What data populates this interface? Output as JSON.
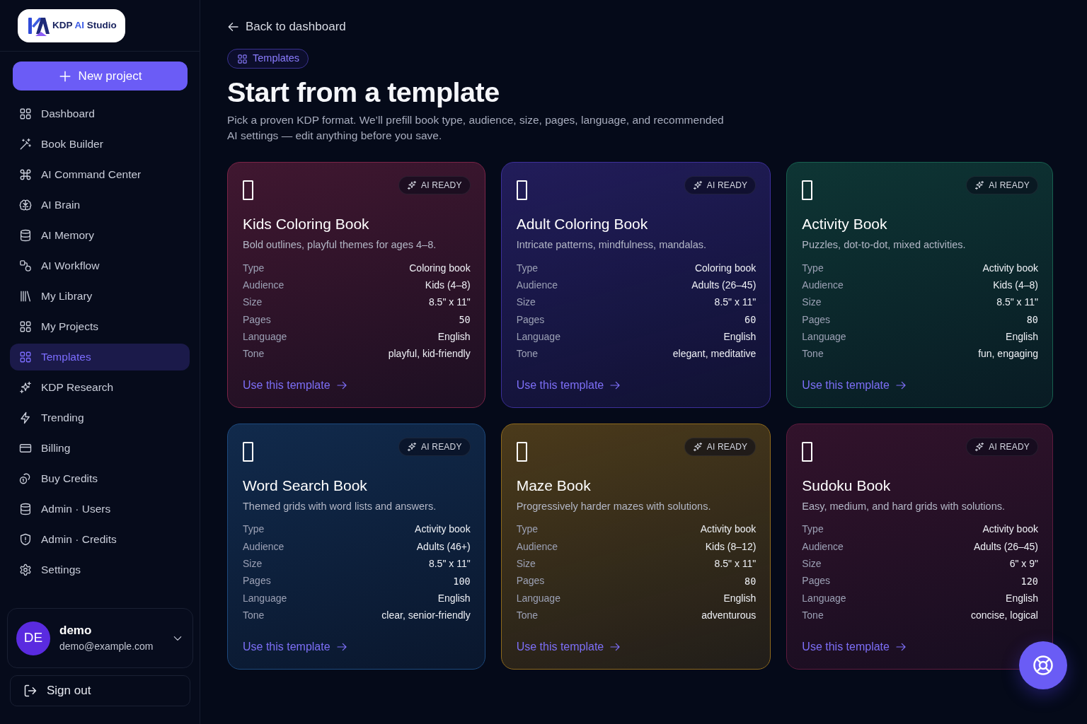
{
  "sidebar": {
    "logo": {
      "parts": [
        {
          "text": "KDP",
          "accent": false
        },
        {
          "text": "AI",
          "accent": true
        },
        {
          "text": "Studio",
          "accent": false
        }
      ]
    },
    "new_project_button": {
      "label": "New project"
    },
    "items": [
      {
        "label": "Dashboard",
        "selected": false
      },
      {
        "label": "Book Builder",
        "selected": false
      },
      {
        "label": "AI Command Center",
        "selected": false
      },
      {
        "label": "AI Brain",
        "selected": false
      },
      {
        "label": "AI Memory",
        "selected": false
      },
      {
        "label": "AI Workflow",
        "selected": false
      },
      {
        "label": "My Library",
        "selected": false
      },
      {
        "label": "My Projects",
        "selected": false
      },
      {
        "label": "Templates",
        "selected": true
      },
      {
        "label": "KDP Research",
        "selected": false
      },
      {
        "label": "Trending",
        "selected": false
      },
      {
        "label": "Billing",
        "selected": false
      },
      {
        "label": "Buy Credits",
        "selected": false
      },
      {
        "label": "Admin · Users",
        "selected": false
      },
      {
        "label": "Admin · Credits",
        "selected": false
      },
      {
        "label": "Settings",
        "selected": false
      }
    ],
    "user": {
      "initials": "DE",
      "name": "demo",
      "email": "demo@example.com"
    },
    "sign_out": {
      "label": "Sign out"
    }
  },
  "back_link": {
    "label": "Back to dashboard"
  },
  "header": {
    "tag": "Templates",
    "title": "Start from a template",
    "description": "Pick a proven KDP format. We’ll prefill book type, audience, size, pages, language, and recommended AI settings — edit anything before you save."
  },
  "templates": [
    {
      "title": "Kids Coloring Book",
      "description": "Bold outlines, playful themes for ages 4–8.",
      "badge": "AI READY",
      "color": "#7b2447",
      "specs": [
        {
          "label": "Type",
          "value": "Coloring book",
          "kind": "text"
        },
        {
          "label": "Audience",
          "value": "Kids (4–8)",
          "kind": "text"
        },
        {
          "label": "Size",
          "value": "8.5\" x 11\"",
          "kind": "text"
        },
        {
          "label": "Pages",
          "value": "50",
          "kind": "number"
        },
        {
          "label": "Language",
          "value": "English",
          "kind": "text"
        },
        {
          "label": "Tone",
          "value": "playful, kid-friendly",
          "kind": "text"
        }
      ],
      "action": "Use this template"
    },
    {
      "title": "Adult Coloring Book",
      "description": "Intricate patterns, mindfulness, mandalas.",
      "badge": "AI READY",
      "color": "#3d2f9a",
      "specs": [
        {
          "label": "Type",
          "value": "Coloring book",
          "kind": "text"
        },
        {
          "label": "Audience",
          "value": "Adults (26–45)",
          "kind": "text"
        },
        {
          "label": "Size",
          "value": "8.5\" x 11\"",
          "kind": "text"
        },
        {
          "label": "Pages",
          "value": "60",
          "kind": "number"
        },
        {
          "label": "Language",
          "value": "English",
          "kind": "text"
        },
        {
          "label": "Tone",
          "value": "elegant, meditative",
          "kind": "text"
        }
      ],
      "action": "Use this template"
    },
    {
      "title": "Activity Book",
      "description": "Puzzles, dot-to-dot, mixed activities.",
      "badge": "AI READY",
      "color": "#17604f",
      "specs": [
        {
          "label": "Type",
          "value": "Activity book",
          "kind": "text"
        },
        {
          "label": "Audience",
          "value": "Kids (4–8)",
          "kind": "text"
        },
        {
          "label": "Size",
          "value": "8.5\" x 11\"",
          "kind": "text"
        },
        {
          "label": "Pages",
          "value": "80",
          "kind": "number"
        },
        {
          "label": "Language",
          "value": "English",
          "kind": "text"
        },
        {
          "label": "Tone",
          "value": "fun, engaging",
          "kind": "text"
        }
      ],
      "action": "Use this template"
    },
    {
      "title": "Word Search Book",
      "description": "Themed grids with word lists and answers.",
      "badge": "AI READY",
      "color": "#1d4a7e",
      "specs": [
        {
          "label": "Type",
          "value": "Activity book",
          "kind": "text"
        },
        {
          "label": "Audience",
          "value": "Adults (46+)",
          "kind": "text"
        },
        {
          "label": "Size",
          "value": "8.5\" x 11\"",
          "kind": "text"
        },
        {
          "label": "Pages",
          "value": "100",
          "kind": "number"
        },
        {
          "label": "Language",
          "value": "English",
          "kind": "text"
        },
        {
          "label": "Tone",
          "value": "clear, senior-friendly",
          "kind": "text"
        }
      ],
      "action": "Use this template"
    },
    {
      "title": "Maze Book",
      "description": "Progressively harder mazes with solutions.",
      "badge": "AI READY",
      "color": "#8f6a1c",
      "specs": [
        {
          "label": "Type",
          "value": "Activity book",
          "kind": "text"
        },
        {
          "label": "Audience",
          "value": "Kids (8–12)",
          "kind": "text"
        },
        {
          "label": "Size",
          "value": "8.5\" x 11\"",
          "kind": "text"
        },
        {
          "label": "Pages",
          "value": "80",
          "kind": "number"
        },
        {
          "label": "Language",
          "value": "English",
          "kind": "text"
        },
        {
          "label": "Tone",
          "value": "adventurous",
          "kind": "text"
        }
      ],
      "action": "Use this template"
    },
    {
      "title": "Sudoku Book",
      "description": "Easy, medium, and hard grids with solutions.",
      "badge": "AI READY",
      "color": "#5e1b3d",
      "specs": [
        {
          "label": "Type",
          "value": "Activity book",
          "kind": "text"
        },
        {
          "label": "Audience",
          "value": "Adults (26–45)",
          "kind": "text"
        },
        {
          "label": "Size",
          "value": "6\" x 9\"",
          "kind": "text"
        },
        {
          "label": "Pages",
          "value": "120",
          "kind": "number"
        },
        {
          "label": "Language",
          "value": "English",
          "kind": "text"
        },
        {
          "label": "Tone",
          "value": "concise, logical",
          "kind": "text"
        }
      ],
      "action": "Use this template"
    }
  ]
}
